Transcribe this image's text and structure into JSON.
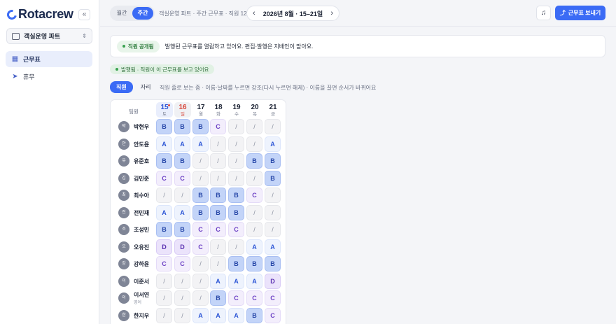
{
  "brand": {
    "name": "Rotacrew"
  },
  "sidebar": {
    "collapse_icon": "double-chevron-left-icon",
    "collapse_glyph": "«",
    "team": {
      "label": "객실운영 파트",
      "icon": "building-icon"
    },
    "items": [
      {
        "label": "근무표",
        "icon": "calendar-icon",
        "glyph": "▦",
        "active": true
      },
      {
        "label": "휴무",
        "icon": "send-icon",
        "glyph": "➤",
        "active": false
      }
    ]
  },
  "header": {
    "tabs": [
      {
        "label": "월간",
        "active": false
      },
      {
        "label": "주간",
        "active": true
      }
    ],
    "subtitle": "객실운영 파트 · 주간 근무표 · 직원 12명",
    "week_label": "2026년 8월 · 15–21일",
    "prev": "‹",
    "next": "›",
    "bell_glyph": "🔔",
    "send_label": "근무표 보내기",
    "send_glyph": "⤴"
  },
  "notice": {
    "badge": "직원 공개됨",
    "text": "발행된 근무표를 열람하고 있어요. 편집·발행은 지배인이 맡아요."
  },
  "status": {
    "text": "발행됨 · 직원이 이 근무표를 보고 있어요"
  },
  "sort": {
    "tabs": [
      {
        "label": "직원",
        "active": true
      },
      {
        "label": "자리",
        "active": false
      }
    ],
    "hint": "직원 줄로 보는 중 · 이름·날짜를 누르면 강조(다시 누르면 해제) · 이름을 끌면 순서가 바뀌어요"
  },
  "grid": {
    "team_header": "팀원",
    "days": [
      {
        "num": "15",
        "wd": "토",
        "state": "today"
      },
      {
        "num": "16",
        "wd": "일",
        "state": "hol"
      },
      {
        "num": "17",
        "wd": "월",
        "state": ""
      },
      {
        "num": "18",
        "wd": "화",
        "state": ""
      },
      {
        "num": "19",
        "wd": "수",
        "state": ""
      },
      {
        "num": "20",
        "wd": "목",
        "state": ""
      },
      {
        "num": "21",
        "wd": "금",
        "state": ""
      }
    ],
    "rows": [
      {
        "initial": "박",
        "name": "박현우",
        "sub": "",
        "shifts": [
          "B",
          "B",
          "B",
          "C",
          "/",
          "/",
          "/"
        ]
      },
      {
        "initial": "안",
        "name": "안도윤",
        "sub": "",
        "shifts": [
          "A",
          "A",
          "A",
          "/",
          "/",
          "/",
          "A"
        ]
      },
      {
        "initial": "유",
        "name": "유준호",
        "sub": "",
        "shifts": [
          "B",
          "B",
          "/",
          "/",
          "/",
          "B",
          "B"
        ]
      },
      {
        "initial": "김",
        "name": "김민준",
        "sub": "",
        "shifts": [
          "C",
          "C",
          "/",
          "/",
          "/",
          "/",
          "B"
        ]
      },
      {
        "initial": "최",
        "name": "최수아",
        "sub": "",
        "shifts": [
          "/",
          "/",
          "B",
          "B",
          "B",
          "C",
          "/"
        ]
      },
      {
        "initial": "전",
        "name": "전민재",
        "sub": "",
        "shifts": [
          "A",
          "A",
          "B",
          "B",
          "B",
          "/",
          "/"
        ]
      },
      {
        "initial": "조",
        "name": "조성민",
        "sub": "",
        "shifts": [
          "B",
          "B",
          "C",
          "C",
          "C",
          "/",
          "/"
        ]
      },
      {
        "initial": "오",
        "name": "오유진",
        "sub": "",
        "shifts": [
          "D",
          "D",
          "C",
          "/",
          "/",
          "A",
          "A"
        ]
      },
      {
        "initial": "강",
        "name": "강하윤",
        "sub": "",
        "shifts": [
          "C",
          "C",
          "/",
          "/",
          "B",
          "B",
          "B"
        ]
      },
      {
        "initial": "이",
        "name": "이준서",
        "sub": "",
        "shifts": [
          "/",
          "/",
          "/",
          "A",
          "A",
          "A",
          "D"
        ]
      },
      {
        "initial": "이",
        "name": "이서연",
        "sub": "영어",
        "shifts": [
          "/",
          "/",
          "/",
          "B",
          "C",
          "C",
          "C"
        ]
      },
      {
        "initial": "한",
        "name": "한지우",
        "sub": "",
        "shifts": [
          "/",
          "/",
          "A",
          "A",
          "A",
          "B",
          "C"
        ]
      }
    ]
  },
  "colors": {
    "accent": "#3b6bf5",
    "holiday": "#d8473b",
    "published_green": "#39a24f"
  }
}
